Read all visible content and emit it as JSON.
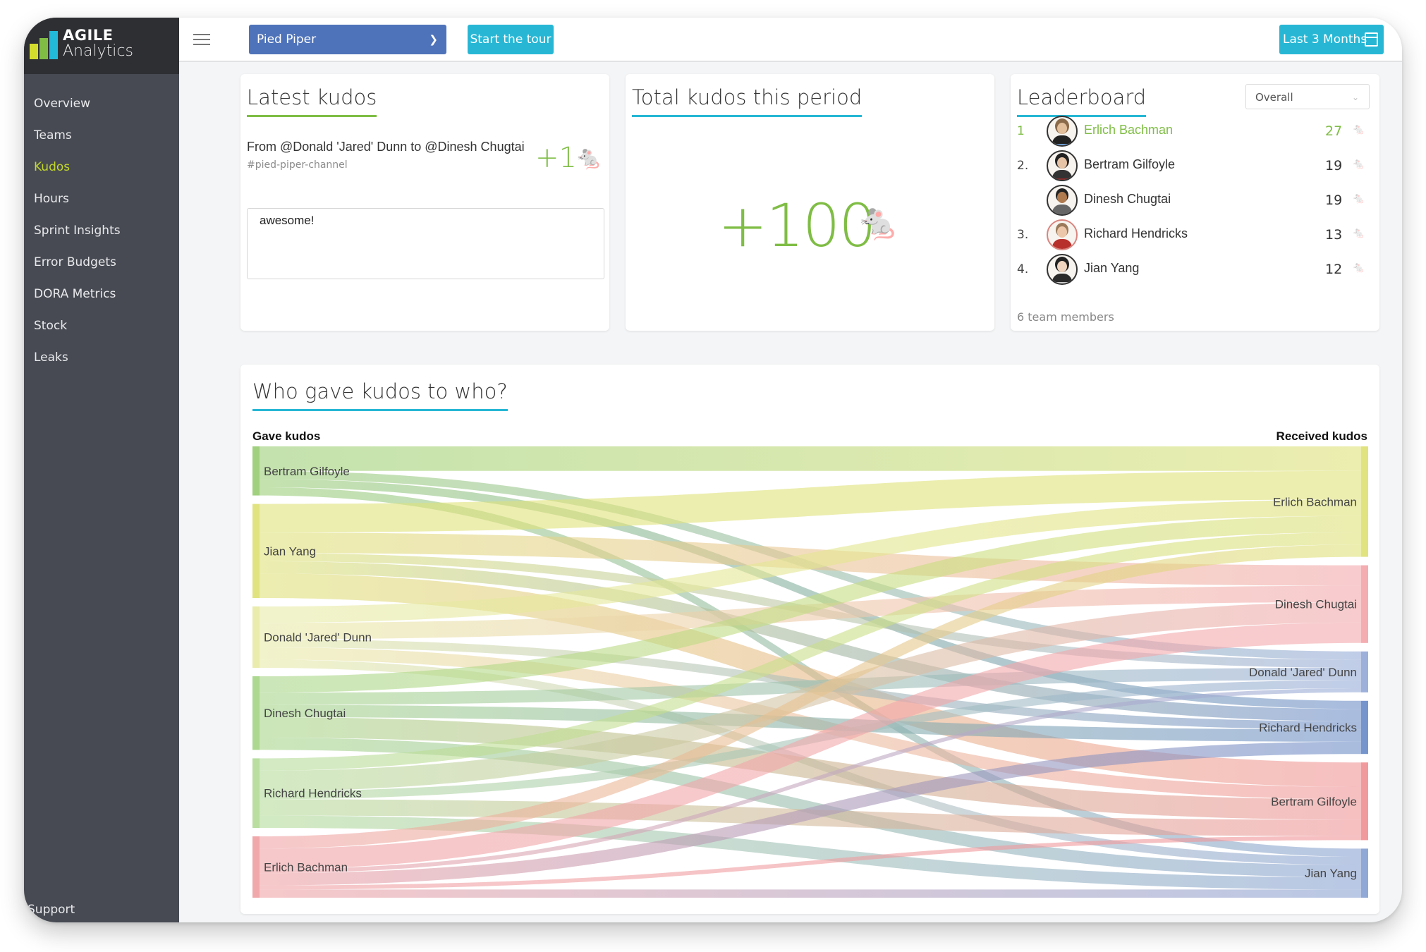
{
  "app": {
    "logo_line1": "AGILE",
    "logo_line2": "Analytics"
  },
  "sidebar": {
    "items": [
      {
        "label": "Overview",
        "active": false
      },
      {
        "label": "Teams",
        "active": false
      },
      {
        "label": "Kudos",
        "active": true
      },
      {
        "label": "Hours",
        "active": false
      },
      {
        "label": "Sprint Insights",
        "active": false
      },
      {
        "label": "Error Budgets",
        "active": false
      },
      {
        "label": "DORA Metrics",
        "active": false
      },
      {
        "label": "Stock",
        "active": false
      },
      {
        "label": "Leaks",
        "active": false
      }
    ],
    "support_label": "Support",
    "active_color": "#c3d82b"
  },
  "topbar": {
    "menu_icon": "hamburger-icon",
    "team_select_value": "Pied Piper",
    "tour_button": "Start the tour",
    "period_button": "Last 3 Months",
    "period_icon": "calendar-icon"
  },
  "latest_kudos": {
    "title": "Latest kudos",
    "from_line": "From @Donald 'Jared' Dunn to @Dinesh Chugtai",
    "channel": "#pied-piper-channel",
    "amount": "+1",
    "icon": "mouse-icon",
    "message": "awesome!"
  },
  "total_kudos": {
    "title": "Total kudos this period",
    "value": "+100",
    "icon": "mouse-icon"
  },
  "leaderboard": {
    "title": "Leaderboard",
    "filter_value": "Overall",
    "rows": [
      {
        "rank": "1",
        "name": "Erlich Bachman",
        "score": "27",
        "first": true
      },
      {
        "rank": "2.",
        "name": "Bertram Gilfoyle",
        "score": "19",
        "first": false
      },
      {
        "rank": "",
        "name": "Dinesh Chugtai",
        "score": "19",
        "first": false
      },
      {
        "rank": "3.",
        "name": "Richard Hendricks",
        "score": "13",
        "first": false
      },
      {
        "rank": "4.",
        "name": "Jian Yang",
        "score": "12",
        "first": false
      }
    ],
    "footer": "6 team members"
  },
  "colors": {
    "accent_green": "#7fbd45",
    "accent_blue": "#27b7d5",
    "select_blue": "#4f73ba",
    "sidebar_bg": "#474a52"
  },
  "chart_data": {
    "type": "sankey",
    "title": "Who gave kudos to who?",
    "left_label": "Gave kudos",
    "right_label": "Received kudos",
    "sources": [
      {
        "name": "Bertram Gilfoyle",
        "value": 12,
        "color": "#9ccf78"
      },
      {
        "name": "Jian Yang",
        "value": 23,
        "color": "#dfe27a"
      },
      {
        "name": "Donald 'Jared' Dunn",
        "value": 15,
        "color": "#e8eba8"
      },
      {
        "name": "Dinesh Chugtai",
        "value": 18,
        "color": "#a8d68a"
      },
      {
        "name": "Richard Hendricks",
        "value": 17,
        "color": "#b5dc9b"
      },
      {
        "name": "Erlich Bachman",
        "value": 15,
        "color": "#f0a3a6"
      }
    ],
    "targets": [
      {
        "name": "Erlich Bachman",
        "value": 27,
        "color": "#dfe27a"
      },
      {
        "name": "Dinesh Chugtai",
        "value": 19,
        "color": "#f3a9ad"
      },
      {
        "name": "Donald 'Jared' Dunn",
        "value": 10,
        "color": "#97acd8"
      },
      {
        "name": "Richard Hendricks",
        "value": 13,
        "color": "#6f8fc9"
      },
      {
        "name": "Bertram Gilfoyle",
        "value": 19,
        "color": "#f09598"
      },
      {
        "name": "Jian Yang",
        "value": 12,
        "color": "#8aa3d3"
      }
    ],
    "links": [
      {
        "source": "Bertram Gilfoyle",
        "target": "Erlich Bachman",
        "value": 6
      },
      {
        "source": "Bertram Gilfoyle",
        "target": "Donald 'Jared' Dunn",
        "value": 2
      },
      {
        "source": "Bertram Gilfoyle",
        "target": "Richard Hendricks",
        "value": 2
      },
      {
        "source": "Bertram Gilfoyle",
        "target": "Jian Yang",
        "value": 2
      },
      {
        "source": "Jian Yang",
        "target": "Erlich Bachman",
        "value": 7
      },
      {
        "source": "Jian Yang",
        "target": "Dinesh Chugtai",
        "value": 5
      },
      {
        "source": "Jian Yang",
        "target": "Donald 'Jared' Dunn",
        "value": 2
      },
      {
        "source": "Jian Yang",
        "target": "Richard Hendricks",
        "value": 3
      },
      {
        "source": "Jian Yang",
        "target": "Bertram Gilfoyle",
        "value": 6
      },
      {
        "source": "Donald 'Jared' Dunn",
        "target": "Erlich Bachman",
        "value": 4
      },
      {
        "source": "Donald 'Jared' Dunn",
        "target": "Dinesh Chugtai",
        "value": 4
      },
      {
        "source": "Donald 'Jared' Dunn",
        "target": "Richard Hendricks",
        "value": 2
      },
      {
        "source": "Donald 'Jared' Dunn",
        "target": "Bertram Gilfoyle",
        "value": 3
      },
      {
        "source": "Donald 'Jared' Dunn",
        "target": "Jian Yang",
        "value": 2
      },
      {
        "source": "Dinesh Chugtai",
        "target": "Erlich Bachman",
        "value": 4
      },
      {
        "source": "Dinesh Chugtai",
        "target": "Dinesh Chugtai",
        "value": 0
      },
      {
        "source": "Dinesh Chugtai",
        "target": "Donald 'Jared' Dunn",
        "value": 3
      },
      {
        "source": "Dinesh Chugtai",
        "target": "Richard Hendricks",
        "value": 3
      },
      {
        "source": "Dinesh Chugtai",
        "target": "Bertram Gilfoyle",
        "value": 5
      },
      {
        "source": "Dinesh Chugtai",
        "target": "Jian Yang",
        "value": 3
      },
      {
        "source": "Richard Hendricks",
        "target": "Erlich Bachman",
        "value": 3
      },
      {
        "source": "Richard Hendricks",
        "target": "Dinesh Chugtai",
        "value": 5
      },
      {
        "source": "Richard Hendricks",
        "target": "Donald 'Jared' Dunn",
        "value": 2
      },
      {
        "source": "Richard Hendricks",
        "target": "Bertram Gilfoyle",
        "value": 4
      },
      {
        "source": "Richard Hendricks",
        "target": "Jian Yang",
        "value": 3
      },
      {
        "source": "Erlich Bachman",
        "target": "Erlich Bachman",
        "value": 3
      },
      {
        "source": "Erlich Bachman",
        "target": "Dinesh Chugtai",
        "value": 5
      },
      {
        "source": "Erlich Bachman",
        "target": "Donald 'Jared' Dunn",
        "value": 1
      },
      {
        "source": "Erlich Bachman",
        "target": "Richard Hendricks",
        "value": 3
      },
      {
        "source": "Erlich Bachman",
        "target": "Bertram Gilfoyle",
        "value": 1
      },
      {
        "source": "Erlich Bachman",
        "target": "Jian Yang",
        "value": 2
      }
    ]
  }
}
